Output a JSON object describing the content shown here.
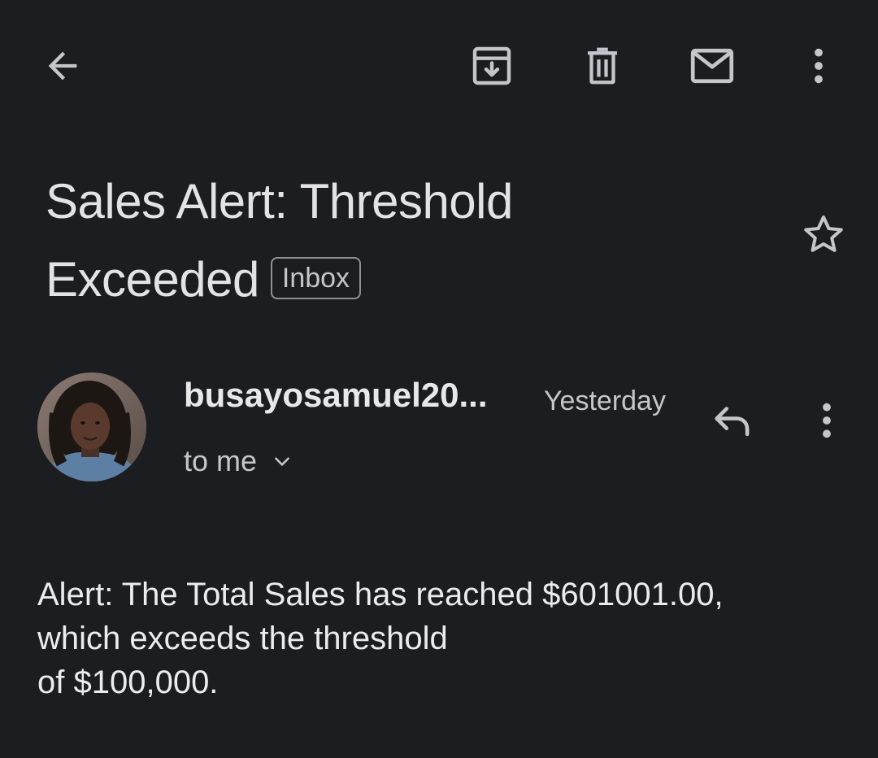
{
  "toolbar": {
    "back_icon": "arrow-left-icon",
    "archive_icon": "archive-icon",
    "delete_icon": "trash-icon",
    "mark_unread_icon": "mail-icon",
    "more_icon": "more-vertical-icon"
  },
  "email": {
    "subject_line1": "Sales Alert: Threshold",
    "subject_line2": "Exceeded",
    "label": "Inbox",
    "starred": false,
    "sender": {
      "name": "busayosamuel20...",
      "time": "Yesterday",
      "recipient": "to me"
    },
    "body_lines": [
      "Alert: The Total Sales has reached $601001.00,",
      "which exceeds the threshold",
      "of $100,000."
    ]
  },
  "colors": {
    "background": "#1c1d20",
    "text": "#e3e3e6",
    "secondary_text": "#c4c6cb",
    "chip_border": "#8e9096"
  }
}
